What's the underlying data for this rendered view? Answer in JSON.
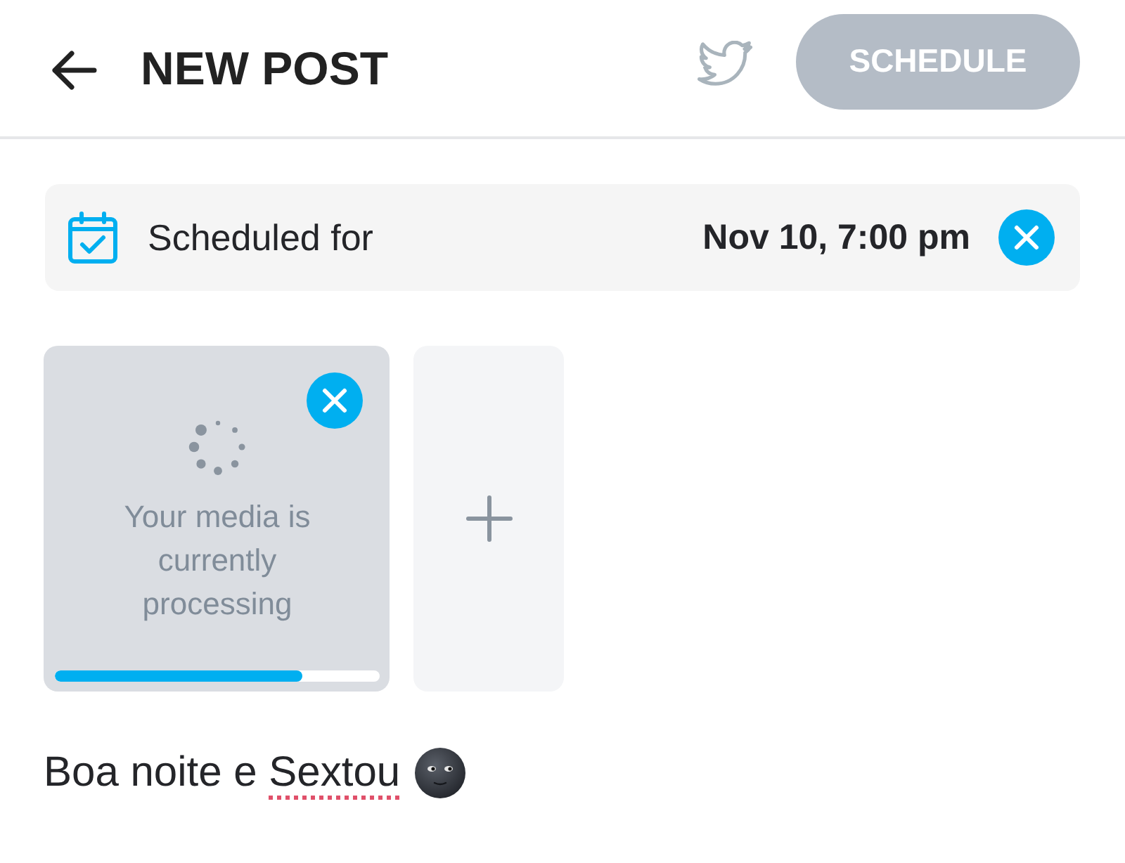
{
  "header": {
    "title": "NEW POST",
    "twitter_share": false,
    "action": {
      "label": "SCHEDULE",
      "disabled": true
    }
  },
  "schedule": {
    "label": "Scheduled for",
    "value": "Nov 10, 7:00 pm"
  },
  "media": [
    {
      "kind": "processing",
      "message": "Your media is currently processing",
      "level": 0.76
    },
    {
      "kind": "add"
    }
  ],
  "caption": {
    "words": [
      {
        "text": "Boa",
        "misspelled": false
      },
      {
        "text": "noite",
        "misspelled": false
      },
      {
        "text": "e",
        "misspelled": false
      },
      {
        "text": "Sextou",
        "misspelled": true
      }
    ]
  }
}
